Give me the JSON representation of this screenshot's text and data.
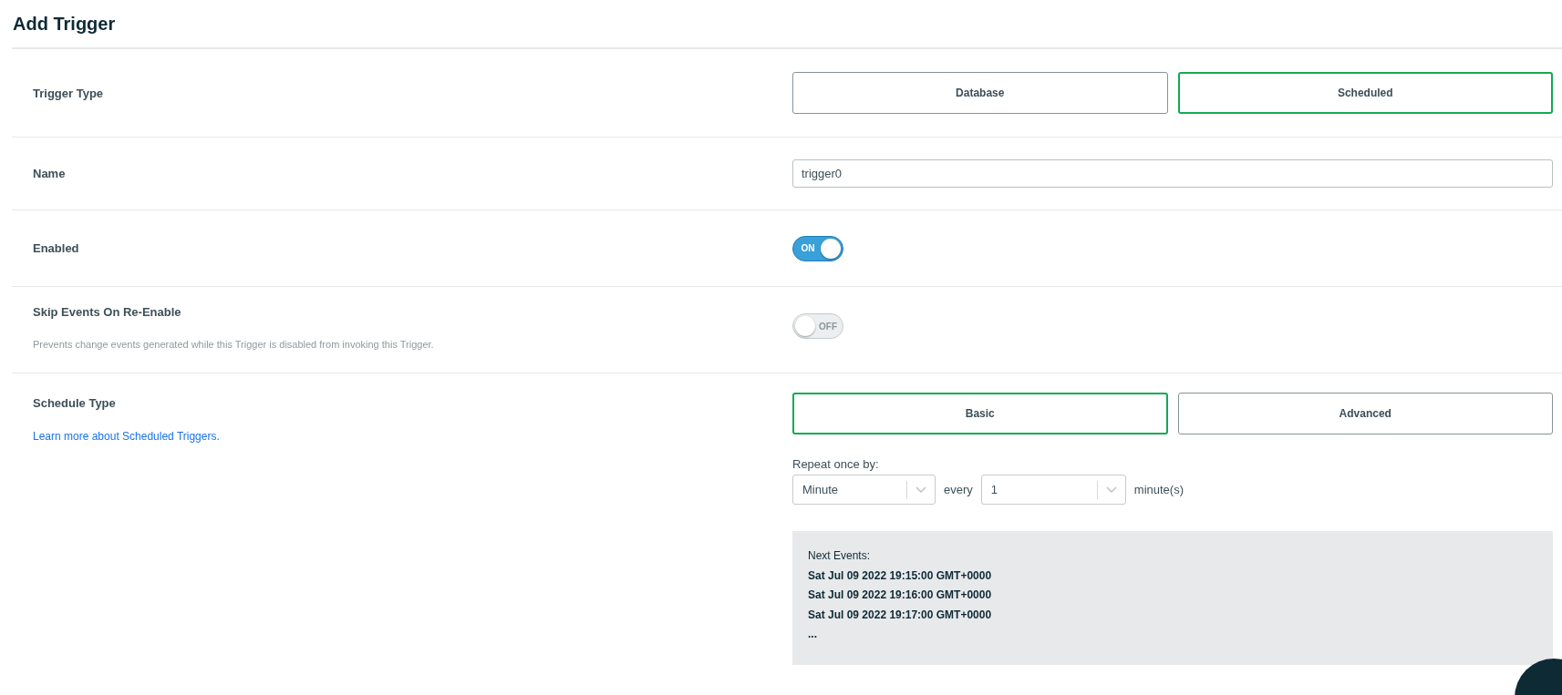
{
  "title": "Add Trigger",
  "trigger_type": {
    "label": "Trigger Type",
    "options": [
      {
        "label": "Database",
        "selected": false
      },
      {
        "label": "Scheduled",
        "selected": true
      }
    ]
  },
  "name": {
    "label": "Name",
    "value": "trigger0"
  },
  "enabled": {
    "label": "Enabled",
    "on": true,
    "state_text": "ON"
  },
  "skip_events": {
    "label": "Skip Events On Re-Enable",
    "description": "Prevents change events generated while this Trigger is disabled from invoking this Trigger.",
    "on": false,
    "state_text": "OFF"
  },
  "schedule_type": {
    "label": "Schedule Type",
    "link": "Learn more about Scheduled Triggers.",
    "options": [
      {
        "label": "Basic",
        "selected": true
      },
      {
        "label": "Advanced",
        "selected": false
      }
    ],
    "repeat_label": "Repeat once by:",
    "unit_select": "Minute",
    "every_label": "every",
    "interval_select": "1",
    "unit_suffix": "minute(s)",
    "next_events": {
      "label": "Next Events:",
      "items": [
        "Sat Jul 09 2022 19:15:00 GMT+0000",
        "Sat Jul 09 2022 19:16:00 GMT+0000",
        "Sat Jul 09 2022 19:17:00 GMT+0000"
      ],
      "more": "..."
    }
  }
}
